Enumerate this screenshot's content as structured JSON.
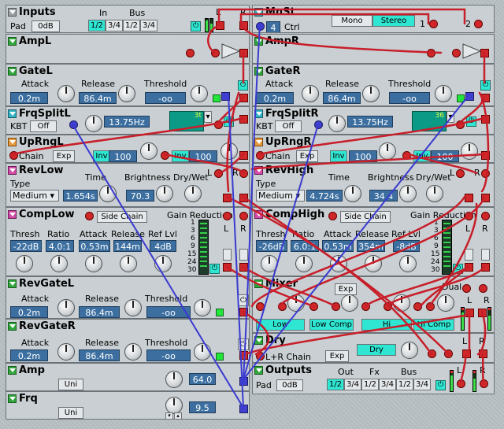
{
  "inputs": {
    "title": "Inputs",
    "pad_label": "Pad",
    "pad_value": "0dB",
    "in_label": "In",
    "bus_label": "Bus",
    "channels": [
      "1/2",
      "3/4",
      "1/2",
      "3/4"
    ],
    "l": "L",
    "r": "R"
  },
  "mnst": {
    "title": "MnSt",
    "mono": "Mono",
    "stereo": "Stereo",
    "ctrl": "Ctrl",
    "ctrl_value": "4",
    "jack1": "1",
    "jack2": "2"
  },
  "ampl": {
    "title": "AmpL"
  },
  "ampr": {
    "title": "AmpR"
  },
  "gatel": {
    "title": "GateL",
    "attack_label": "Attack",
    "attack": "0.2m",
    "release_label": "Release",
    "release": "86.4m",
    "threshold_label": "Threshold",
    "threshold": "-oo"
  },
  "gater": {
    "title": "GateR",
    "attack_label": "Attack",
    "attack": "0.2m",
    "release_label": "Release",
    "release": "86.4m",
    "threshold_label": "Threshold",
    "threshold": "-oo"
  },
  "frqsplitl": {
    "title": "FrqSplitL",
    "kbt_label": "KBT",
    "kbt": "Off",
    "freq": "13.75Hz",
    "display": "3t"
  },
  "frqsplitr": {
    "title": "FrqSplitR",
    "kbt_label": "KBT",
    "kbt": "Off",
    "freq": "13.75Hz",
    "display": "36"
  },
  "uprngl": {
    "title": "UpRngL",
    "chain": "Chain",
    "exp": "Exp",
    "inv": "Inv",
    "v1": "100",
    "v2": "100"
  },
  "uprngr": {
    "title": "UpRngR",
    "chain": "Chain",
    "exp": "Exp",
    "inv": "Inv",
    "v1": "100",
    "v2": "100"
  },
  "revlow": {
    "title": "RevLow",
    "type_label": "Type",
    "type": "Medium",
    "time_label": "Time",
    "time": "1.654s",
    "bright_label": "Brightness",
    "bright": "70.3",
    "drywet_label": "Dry/Wet",
    "l": "L",
    "r": "R"
  },
  "revhigh": {
    "title": "RevHigh",
    "type_label": "Type",
    "type": "Medium",
    "time_label": "Time",
    "time": "4.724s",
    "bright_label": "Brightness",
    "bright": "34.4",
    "drywet_label": "Dry/Wet",
    "l": "L",
    "r": "R"
  },
  "complow": {
    "title": "CompLow",
    "side_chain": "Side Chain",
    "gain_reduction": "Gain Reduction",
    "thresh_label": "Thresh",
    "thresh": "-22dB",
    "ratio_label": "Ratio",
    "ratio": "4.0:1",
    "attack_label": "Attack",
    "attack": "0.53m",
    "release_label": "Release",
    "release": "144m",
    "reflvl_label": "Ref Lvl",
    "reflvl": "4dB",
    "scale": [
      "1",
      "3",
      "6",
      "9",
      "15",
      "24",
      "30"
    ],
    "l": "L",
    "r": "R"
  },
  "comphigh": {
    "title": "CompHigh",
    "side_chain": "Side Chain",
    "gain_reduction": "Gain Reduction",
    "thresh_label": "Thresh",
    "thresh": "-26dB",
    "ratio_label": "Ratio",
    "ratio": "6.0:1",
    "attack_label": "Attack",
    "attack": "0.53m",
    "release_label": "Release",
    "release": "354m",
    "reflvl_label": "Ref Lvl",
    "reflvl": "-8dB",
    "scale": [
      "1",
      "3",
      "6",
      "9",
      "15",
      "24",
      "30"
    ],
    "l": "L",
    "r": "R"
  },
  "revgatel": {
    "title": "RevGateL",
    "attack_label": "Attack",
    "attack": "0.2m",
    "release_label": "Release",
    "release": "86.4m",
    "threshold_label": "Threshold",
    "threshold": "-oo"
  },
  "revgater": {
    "title": "RevGateR",
    "attack_label": "Attack",
    "attack": "0.2m",
    "release_label": "Release",
    "release": "86.4m",
    "threshold_label": "Threshold",
    "threshold": "-oo"
  },
  "mixer": {
    "title": "Mixer",
    "exp": "Exp",
    "dual": "Dual",
    "l": "L",
    "r": "R",
    "channels": [
      "Low",
      "Low Comp",
      "Hi",
      "Hi Comp"
    ]
  },
  "dry": {
    "title": "Dry",
    "lr_chain": "L+R Chain",
    "exp": "Exp",
    "dry_btn": "Dry",
    "l": "L",
    "r": "R"
  },
  "amp": {
    "title": "Amp",
    "uni": "Uni",
    "value": "64.0"
  },
  "outputs": {
    "title": "Outputs",
    "pad_label": "Pad",
    "pad_value": "0dB",
    "out_label": "Out",
    "fx_label": "Fx",
    "bus_label": "Bus",
    "channels": [
      "1/2",
      "3/4",
      "1/2",
      "3/4",
      "1/2",
      "3/4"
    ],
    "l": "L",
    "r": "R"
  },
  "frq": {
    "title": "Frq",
    "uni": "Uni",
    "value": "9.5"
  },
  "colors": {
    "cable_red": "#c81e2a",
    "cable_blue": "#3a3ad0",
    "panel": "#c9cfd2",
    "accent_cyan": "#2fe6d2"
  }
}
